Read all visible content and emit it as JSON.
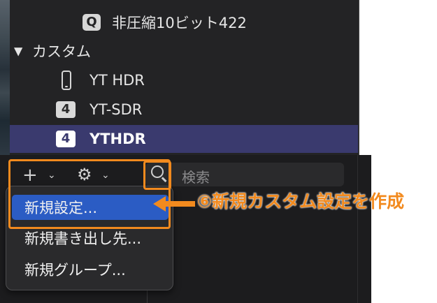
{
  "preset_list": {
    "items": [
      {
        "label": "非圧縮10ビット422",
        "icon": "quicktime-q-icon",
        "icon_text": "Q"
      },
      {
        "label": "カスタム",
        "type": "group-header",
        "expanded": true
      },
      {
        "label": "YT HDR",
        "icon": "iphone-icon"
      },
      {
        "label": "YT-SDR",
        "icon": "number-badge-icon",
        "icon_text": "4"
      },
      {
        "label": "YTHDR",
        "icon": "number-badge-icon",
        "icon_text": "4",
        "selected": true
      }
    ]
  },
  "toolbar": {
    "add_icon": "plus-icon",
    "settings_icon": "gear-icon",
    "search_placeholder": "検索"
  },
  "menu": {
    "items": [
      {
        "label": "新規設定...",
        "highlighted": true
      },
      {
        "label": "新規書き出し先..."
      },
      {
        "label": "新規グループ..."
      }
    ]
  },
  "annotation": {
    "text": "⑥新規カスタム設定を作成",
    "color": "#f28a1e"
  },
  "colors": {
    "selection": "#3a3a6e",
    "menu_highlight": "#2b5cc4",
    "panel_bg": "#232325"
  }
}
